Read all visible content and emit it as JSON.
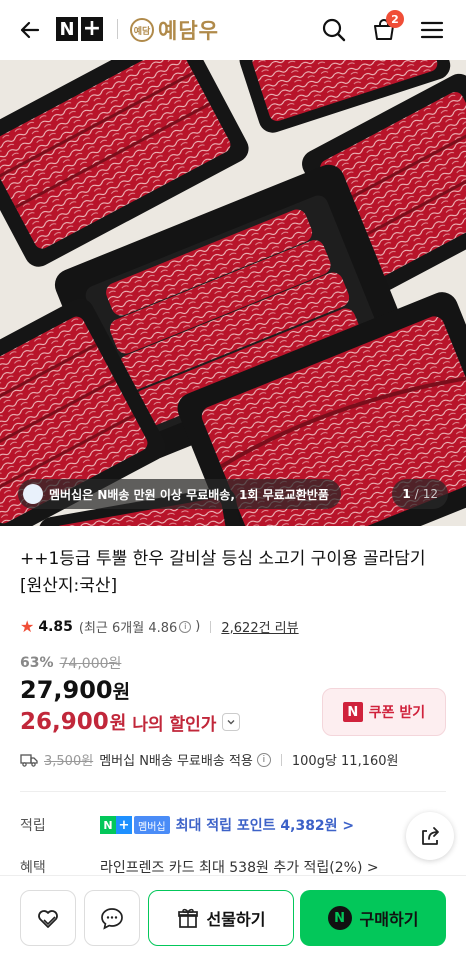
{
  "header": {
    "n_label": "N",
    "plus_label": "+",
    "brand_seal": "예담",
    "brand_name": "예담우",
    "cart_count": "2"
  },
  "hero": {
    "notice": "멤버십은 N배송 만원 이상 무료배송, 1회 무료교환반품",
    "current_index": "1",
    "separator": "/",
    "total": "12"
  },
  "product": {
    "title": "++1등급 투뿔 한우 갈비살 등심 소고기 구이용 골라담기 [원산지:국산]",
    "rating": "4.85",
    "recent_rating_text": "(최근 6개월 4.86",
    "recent_rating_close": ")",
    "review_count": "2,622건 리뷰",
    "discount_pct": "63%",
    "original_price": "74,000원",
    "price": "27,900",
    "price_unit": "원",
    "my_price": "26,900",
    "my_price_unit": "원",
    "my_price_label": "나의 할인가",
    "coupon_label": "쿠폰 받기",
    "coupon_logo": "N",
    "shipping_orig": "3,500원",
    "shipping_text": "멤버십 N배송 무료배송 적용",
    "unit_price": "100g당 11,160원"
  },
  "info_rows": {
    "points_label": "적립",
    "points_badge_n": "N",
    "points_badge_plus": "+",
    "points_badge_text": "멤버십",
    "points_text": "최대 적립 포인트 4,382원 >",
    "benefit_label": "혜택",
    "benefit_text": "라인프렌즈 카드 최대 538원 추가 적립(2%) >"
  },
  "bottom_bar": {
    "gift_label": "선물하기",
    "buy_label": "구매하기",
    "buy_logo": "N"
  },
  "colors": {
    "accent_green": "#03c75a",
    "sale_red": "#c1273a",
    "brand_gold": "#b08a4a",
    "badge_red": "#f04e37"
  },
  "icons": [
    "back-arrow-icon",
    "search-icon",
    "cart-icon",
    "menu-icon",
    "share-icon",
    "wish-heart-icon",
    "talk-bubble-icon",
    "gift-box-icon",
    "star-icon",
    "info-icon",
    "truck-icon",
    "chevron-down-icon"
  ]
}
